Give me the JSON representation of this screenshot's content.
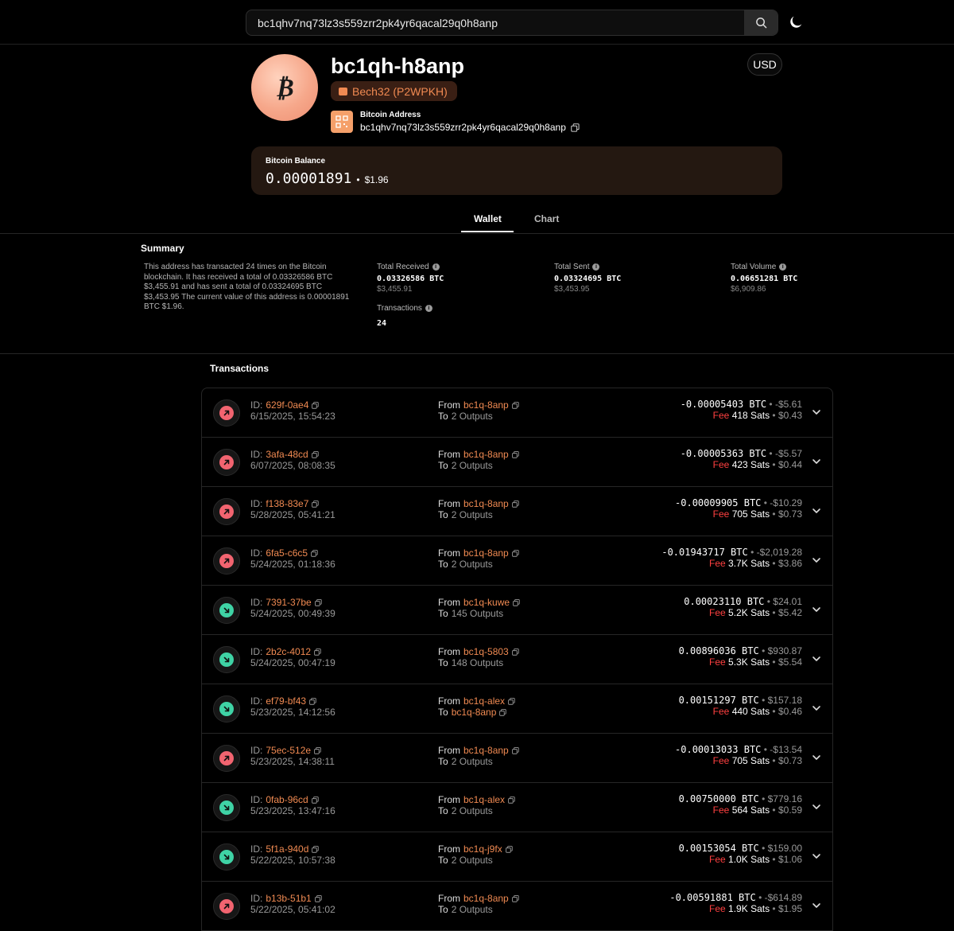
{
  "search": {
    "value": "bc1qhv7nq73lz3s559zrr2pk4yr6qacal29q0h8anp"
  },
  "header": {
    "avatar_glyph": "₿",
    "short_address": "bc1qh-h8anp",
    "type_badge": "Bech32 (P2WPKH)",
    "address_label": "Bitcoin Address",
    "full_address": "bc1qhv7nq73lz3s559zrr2pk4yr6qacal29q0h8anp",
    "currency": "USD"
  },
  "balance": {
    "label": "Bitcoin Balance",
    "btc": "0.00001891",
    "sep": "•",
    "fiat": "$1.96"
  },
  "tabs": [
    {
      "label": "Wallet"
    },
    {
      "label": "Chart"
    }
  ],
  "summary": {
    "title": "Summary",
    "text": "This address has transacted 24 times on the Bitcoin blockchain. It has received a total of 0.03326586 BTC $3,455.91 and has sent a total of 0.03324695 BTC $3,453.95 The current value of this address is 0.00001891 BTC $1.96.",
    "stats": [
      {
        "label": "Total Received",
        "value": "0.03326586 BTC",
        "fiat": "$3,455.91"
      },
      {
        "label": "Total Sent",
        "value": "0.03324695 BTC",
        "fiat": "$3,453.95"
      },
      {
        "label": "Total Volume",
        "value": "0.06651281 BTC",
        "fiat": "$6,909.86"
      },
      {
        "label": "Transactions",
        "value": "24"
      }
    ]
  },
  "transactions": {
    "title": "Transactions",
    "labels": {
      "id": "ID:",
      "from": "From",
      "to": "To",
      "fee": "Fee",
      "sep": "•"
    },
    "rows": [
      {
        "dir": "out",
        "id": "629f-0ae4",
        "date": "6/15/2025, 15:54:23",
        "from": "bc1q-8anp",
        "to": "2 Outputs",
        "to_is_addr": false,
        "amount": "-0.00005403 BTC",
        "amount_fiat": "-$5.61",
        "fee": "418 Sats",
        "fee_fiat": "$0.43"
      },
      {
        "dir": "out",
        "id": "3afa-48cd",
        "date": "6/07/2025, 08:08:35",
        "from": "bc1q-8anp",
        "to": "2 Outputs",
        "to_is_addr": false,
        "amount": "-0.00005363 BTC",
        "amount_fiat": "-$5.57",
        "fee": "423 Sats",
        "fee_fiat": "$0.44"
      },
      {
        "dir": "out",
        "id": "f138-83e7",
        "date": "5/28/2025, 05:41:21",
        "from": "bc1q-8anp",
        "to": "2 Outputs",
        "to_is_addr": false,
        "amount": "-0.00009905 BTC",
        "amount_fiat": "-$10.29",
        "fee": "705 Sats",
        "fee_fiat": "$0.73"
      },
      {
        "dir": "out",
        "id": "6fa5-c6c5",
        "date": "5/24/2025, 01:18:36",
        "from": "bc1q-8anp",
        "to": "2 Outputs",
        "to_is_addr": false,
        "amount": "-0.01943717 BTC",
        "amount_fiat": "-$2,019.28",
        "fee": "3.7K Sats",
        "fee_fiat": "$3.86"
      },
      {
        "dir": "in",
        "id": "7391-37be",
        "date": "5/24/2025, 00:49:39",
        "from": "bc1q-kuwe",
        "to": "145 Outputs",
        "to_is_addr": false,
        "amount": "0.00023110 BTC",
        "amount_fiat": "$24.01",
        "fee": "5.2K Sats",
        "fee_fiat": "$5.42"
      },
      {
        "dir": "in",
        "id": "2b2c-4012",
        "date": "5/24/2025, 00:47:19",
        "from": "bc1q-5803",
        "to": "148 Outputs",
        "to_is_addr": false,
        "amount": "0.00896036 BTC",
        "amount_fiat": "$930.87",
        "fee": "5.3K Sats",
        "fee_fiat": "$5.54"
      },
      {
        "dir": "in",
        "id": "ef79-bf43",
        "date": "5/23/2025, 14:12:56",
        "from": "bc1q-alex",
        "to": "bc1q-8anp",
        "to_is_addr": true,
        "amount": "0.00151297 BTC",
        "amount_fiat": "$157.18",
        "fee": "440 Sats",
        "fee_fiat": "$0.46"
      },
      {
        "dir": "out",
        "id": "75ec-512e",
        "date": "5/23/2025, 14:38:11",
        "from": "bc1q-8anp",
        "to": "2 Outputs",
        "to_is_addr": false,
        "amount": "-0.00013033 BTC",
        "amount_fiat": "-$13.54",
        "fee": "705 Sats",
        "fee_fiat": "$0.73"
      },
      {
        "dir": "in",
        "id": "0fab-96cd",
        "date": "5/23/2025, 13:47:16",
        "from": "bc1q-alex",
        "to": "2 Outputs",
        "to_is_addr": false,
        "amount": "0.00750000 BTC",
        "amount_fiat": "$779.16",
        "fee": "564 Sats",
        "fee_fiat": "$0.59"
      },
      {
        "dir": "in",
        "id": "5f1a-940d",
        "date": "5/22/2025, 10:57:38",
        "from": "bc1q-j9fx",
        "to": "2 Outputs",
        "to_is_addr": false,
        "amount": "0.00153054 BTC",
        "amount_fiat": "$159.00",
        "fee": "1.0K Sats",
        "fee_fiat": "$1.06"
      },
      {
        "dir": "out",
        "id": "b13b-51b1",
        "date": "5/22/2025, 05:41:02",
        "from": "bc1q-8anp",
        "to": "2 Outputs",
        "to_is_addr": false,
        "amount": "-0.00591881 BTC",
        "amount_fiat": "-$614.89",
        "fee": "1.9K Sats",
        "fee_fiat": "$1.95"
      }
    ]
  },
  "colors": {
    "accent": "#f08a52",
    "out": "#f26470",
    "in": "#3fd3a5",
    "fee": "#ff4040",
    "balance_bg": "#241811"
  }
}
